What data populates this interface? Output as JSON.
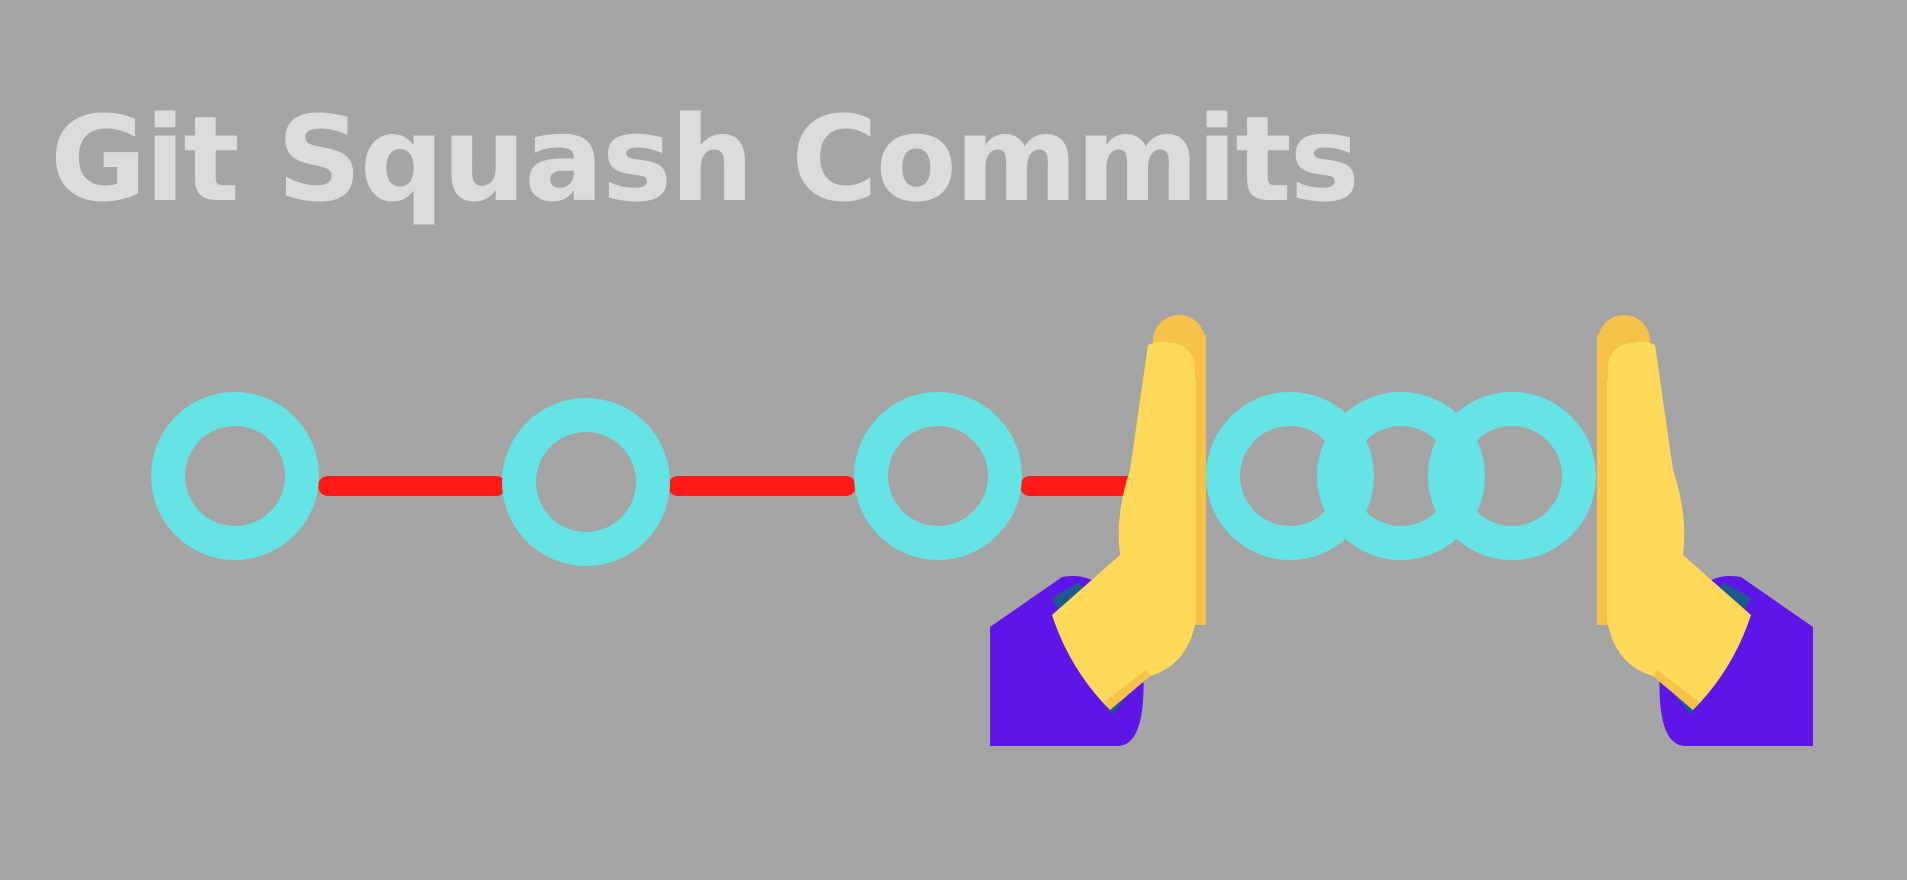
{
  "title": "Git Squash Commits",
  "colors": {
    "background": "#a5a5a5",
    "title": "#dcdcdc",
    "commit_ring": "#66e3e5",
    "connector": "#ff1a1a",
    "hand": "#ffd95a",
    "hand_shade": "#f6c24a",
    "sleeve": "#5e16e8",
    "cuff": "#1c5a8e"
  },
  "commit_graph": {
    "commits_before_squash": 3,
    "commits_being_squashed": 3
  },
  "icons": {
    "left_hand": "pushing-hand-icon",
    "right_hand": "pushing-hand-icon"
  }
}
